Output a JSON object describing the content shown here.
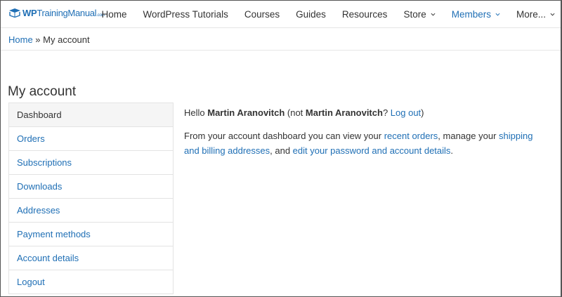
{
  "logo": {
    "brand_bold": "WP",
    "brand_rest": "TrainingManual",
    "brand_suffix": ".com"
  },
  "nav": {
    "items": [
      {
        "label": "Home"
      },
      {
        "label": "WordPress Tutorials"
      },
      {
        "label": "Courses"
      },
      {
        "label": "Guides"
      },
      {
        "label": "Resources"
      },
      {
        "label": "Store"
      },
      {
        "label": "Members"
      },
      {
        "label": "More..."
      }
    ]
  },
  "breadcrumb": {
    "home": "Home",
    "separator": " » ",
    "current": "My account"
  },
  "page": {
    "title": "My account"
  },
  "account_nav": {
    "items": [
      {
        "label": "Dashboard"
      },
      {
        "label": "Orders"
      },
      {
        "label": "Subscriptions"
      },
      {
        "label": "Downloads"
      },
      {
        "label": "Addresses"
      },
      {
        "label": "Payment methods"
      },
      {
        "label": "Account details"
      },
      {
        "label": "Logout"
      }
    ]
  },
  "dashboard": {
    "hello": "Hello ",
    "user_name": "Martin Aranovitch",
    "not_prefix": " (not ",
    "not_name": "Martin Aranovitch",
    "not_suffix": "? ",
    "logout_link": "Log out",
    "close_paren": ")",
    "intro": "From your account dashboard you can view your ",
    "recent_orders_link": "recent orders",
    "manage_text": ", manage your ",
    "addresses_link": "shipping and billing addresses",
    "and_text": ", and ",
    "account_link": "edit your password and account details",
    "end_text": "."
  },
  "colors": {
    "link": "#1f6fb5",
    "text": "#333333",
    "border": "#e3e3e3"
  }
}
